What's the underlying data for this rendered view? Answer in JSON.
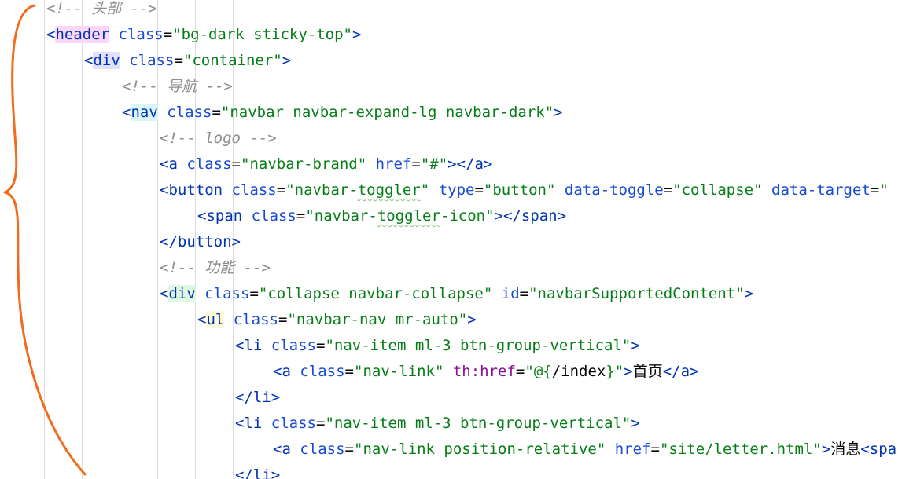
{
  "editor": {
    "accent_stroke": "#f26a1b",
    "tag_highlights": {
      "header": "#fbd6f6",
      "div": "#e0e0fb",
      "nav": "#d9f7f6",
      "collapse_div": "#dff8e0",
      "ul": "#fbf9d6"
    },
    "lines": [
      {
        "indent": 0,
        "tokens": [
          {
            "t": "comment",
            "v": "<!-- 头部 -->"
          }
        ]
      },
      {
        "indent": 0,
        "tokens": [
          {
            "t": "tag",
            "v": "<"
          },
          {
            "t": "tag",
            "v": "header",
            "hl": "header"
          },
          {
            "t": "text",
            "v": " "
          },
          {
            "t": "attr",
            "v": "class"
          },
          {
            "t": "text",
            "v": "="
          },
          {
            "t": "val",
            "v": "\"bg-dark sticky-top\""
          },
          {
            "t": "tag",
            "v": ">"
          }
        ]
      },
      {
        "indent": 1,
        "tokens": [
          {
            "t": "tag",
            "v": "<"
          },
          {
            "t": "tag",
            "v": "div",
            "hl": "div"
          },
          {
            "t": "text",
            "v": " "
          },
          {
            "t": "attr",
            "v": "class"
          },
          {
            "t": "text",
            "v": "="
          },
          {
            "t": "val",
            "v": "\"container\""
          },
          {
            "t": "tag",
            "v": ">"
          }
        ]
      },
      {
        "indent": 2,
        "tokens": [
          {
            "t": "comment",
            "v": "<!-- 导航 -->"
          }
        ]
      },
      {
        "indent": 2,
        "tokens": [
          {
            "t": "tag",
            "v": "<"
          },
          {
            "t": "tag",
            "v": "nav",
            "hl": "nav"
          },
          {
            "t": "text",
            "v": " "
          },
          {
            "t": "attr",
            "v": "class"
          },
          {
            "t": "text",
            "v": "="
          },
          {
            "t": "val",
            "v": "\"navbar navbar-expand-lg navbar-dark\""
          },
          {
            "t": "tag",
            "v": ">"
          }
        ]
      },
      {
        "indent": 3,
        "tokens": [
          {
            "t": "comment",
            "v": "<!-- logo -->"
          }
        ]
      },
      {
        "indent": 3,
        "tokens": [
          {
            "t": "tag",
            "v": "<a"
          },
          {
            "t": "text",
            "v": " "
          },
          {
            "t": "attr",
            "v": "class"
          },
          {
            "t": "text",
            "v": "="
          },
          {
            "t": "val",
            "v": "\"navbar-brand\""
          },
          {
            "t": "text",
            "v": " "
          },
          {
            "t": "attr",
            "v": "href"
          },
          {
            "t": "text",
            "v": "="
          },
          {
            "t": "val",
            "v": "\"#\""
          },
          {
            "t": "tag",
            "v": "></a>"
          }
        ]
      },
      {
        "indent": 3,
        "tokens": [
          {
            "t": "tag",
            "v": "<button"
          },
          {
            "t": "text",
            "v": " "
          },
          {
            "t": "attr",
            "v": "class"
          },
          {
            "t": "text",
            "v": "="
          },
          {
            "t": "val",
            "v": "\"navbar-"
          },
          {
            "t": "val",
            "v": "toggler",
            "sq": true
          },
          {
            "t": "val",
            "v": "\""
          },
          {
            "t": "text",
            "v": " "
          },
          {
            "t": "attr",
            "v": "type"
          },
          {
            "t": "text",
            "v": "="
          },
          {
            "t": "val",
            "v": "\"button\""
          },
          {
            "t": "text",
            "v": " "
          },
          {
            "t": "attr",
            "v": "data-toggle"
          },
          {
            "t": "text",
            "v": "="
          },
          {
            "t": "val",
            "v": "\"collapse\""
          },
          {
            "t": "text",
            "v": " "
          },
          {
            "t": "attr",
            "v": "data-target"
          },
          {
            "t": "text",
            "v": "="
          },
          {
            "t": "val",
            "v": "\""
          }
        ]
      },
      {
        "indent": 4,
        "tokens": [
          {
            "t": "tag",
            "v": "<span"
          },
          {
            "t": "text",
            "v": " "
          },
          {
            "t": "attr",
            "v": "class"
          },
          {
            "t": "text",
            "v": "="
          },
          {
            "t": "val",
            "v": "\"navbar-"
          },
          {
            "t": "val",
            "v": "toggler",
            "sq": true
          },
          {
            "t": "val",
            "v": "-icon\""
          },
          {
            "t": "tag",
            "v": "></span>"
          }
        ]
      },
      {
        "indent": 3,
        "tokens": [
          {
            "t": "tag",
            "v": "</button>"
          }
        ]
      },
      {
        "indent": 3,
        "tokens": [
          {
            "t": "comment",
            "v": "<!-- 功能 -->"
          }
        ]
      },
      {
        "indent": 3,
        "tokens": [
          {
            "t": "tag",
            "v": "<"
          },
          {
            "t": "tag",
            "v": "div",
            "hl": "collapse_div"
          },
          {
            "t": "text",
            "v": " "
          },
          {
            "t": "attr",
            "v": "class"
          },
          {
            "t": "text",
            "v": "="
          },
          {
            "t": "val",
            "v": "\"collapse navbar-collapse\""
          },
          {
            "t": "text",
            "v": " "
          },
          {
            "t": "attr",
            "v": "id"
          },
          {
            "t": "text",
            "v": "="
          },
          {
            "t": "val",
            "v": "\"navbarSupportedContent\""
          },
          {
            "t": "tag",
            "v": ">"
          }
        ]
      },
      {
        "indent": 4,
        "tokens": [
          {
            "t": "tag",
            "v": "<"
          },
          {
            "t": "tag",
            "v": "ul",
            "hl": "ul"
          },
          {
            "t": "text",
            "v": " "
          },
          {
            "t": "attr",
            "v": "class"
          },
          {
            "t": "text",
            "v": "="
          },
          {
            "t": "val",
            "v": "\"navbar-nav mr-auto\""
          },
          {
            "t": "tag",
            "v": ">"
          }
        ]
      },
      {
        "indent": 5,
        "tokens": [
          {
            "t": "tag",
            "v": "<li"
          },
          {
            "t": "text",
            "v": " "
          },
          {
            "t": "attr",
            "v": "class"
          },
          {
            "t": "text",
            "v": "="
          },
          {
            "t": "val",
            "v": "\"nav-item ml-3 btn-group-vertical\""
          },
          {
            "t": "tag",
            "v": ">"
          }
        ]
      },
      {
        "indent": 6,
        "tokens": [
          {
            "t": "tag",
            "v": "<a"
          },
          {
            "t": "text",
            "v": " "
          },
          {
            "t": "attr",
            "v": "class"
          },
          {
            "t": "text",
            "v": "="
          },
          {
            "t": "val",
            "v": "\"nav-link\""
          },
          {
            "t": "text",
            "v": " "
          },
          {
            "t": "th",
            "v": "th:href"
          },
          {
            "t": "text",
            "v": "="
          },
          {
            "t": "val",
            "v": "\"@{"
          },
          {
            "t": "expr",
            "v": "/index"
          },
          {
            "t": "val",
            "v": "}\""
          },
          {
            "t": "tag",
            "v": ">"
          },
          {
            "t": "text",
            "v": "首页"
          },
          {
            "t": "tag",
            "v": "</a>"
          }
        ]
      },
      {
        "indent": 5,
        "tokens": [
          {
            "t": "tag",
            "v": "</li>"
          }
        ]
      },
      {
        "indent": 5,
        "tokens": [
          {
            "t": "tag",
            "v": "<li"
          },
          {
            "t": "text",
            "v": " "
          },
          {
            "t": "attr",
            "v": "class"
          },
          {
            "t": "text",
            "v": "="
          },
          {
            "t": "val",
            "v": "\"nav-item ml-3 btn-group-vertical\""
          },
          {
            "t": "tag",
            "v": ">"
          }
        ]
      },
      {
        "indent": 6,
        "tokens": [
          {
            "t": "tag",
            "v": "<a"
          },
          {
            "t": "text",
            "v": " "
          },
          {
            "t": "attr",
            "v": "class"
          },
          {
            "t": "text",
            "v": "="
          },
          {
            "t": "val",
            "v": "\"nav-link position-relative\""
          },
          {
            "t": "text",
            "v": " "
          },
          {
            "t": "attr",
            "v": "href"
          },
          {
            "t": "text",
            "v": "="
          },
          {
            "t": "val",
            "v": "\"site/letter.html\""
          },
          {
            "t": "tag",
            "v": ">"
          },
          {
            "t": "text",
            "v": "消息"
          },
          {
            "t": "tag",
            "v": "<spa"
          }
        ]
      },
      {
        "indent": 5,
        "tokens": [
          {
            "t": "tag",
            "v": "</li>"
          }
        ]
      }
    ]
  }
}
